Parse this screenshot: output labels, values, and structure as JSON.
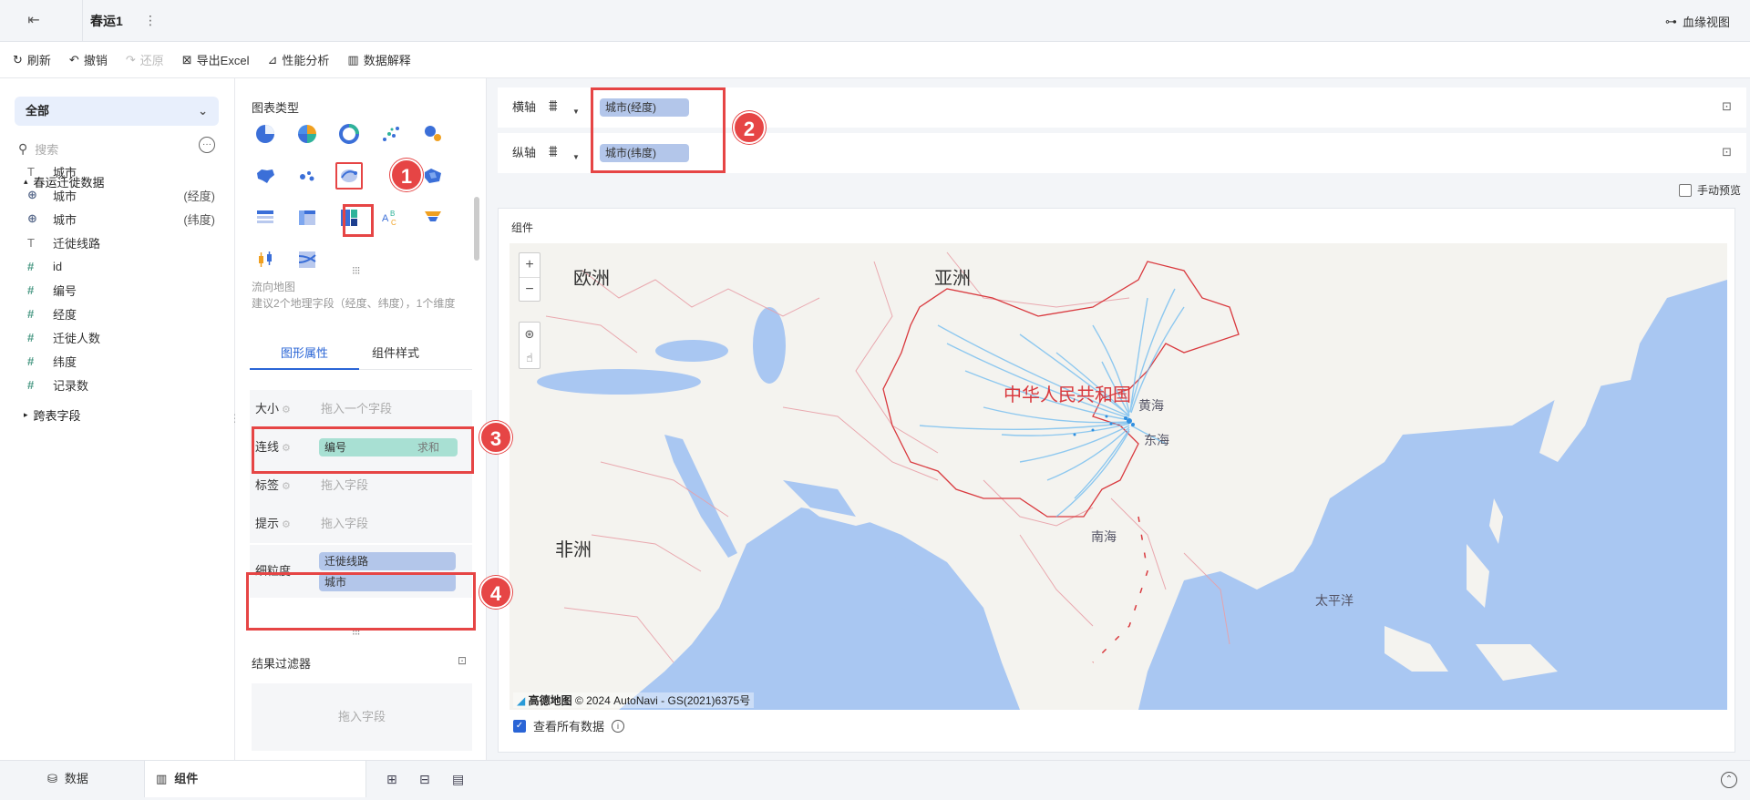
{
  "header": {
    "tab_title": "春运1",
    "more": "⋮",
    "lineage_label": "血缘视图"
  },
  "toolbar": {
    "refresh": "刷新",
    "undo": "撤销",
    "redo": "还原",
    "export_excel": "导出Excel",
    "perf_analysis": "性能分析",
    "data_explain": "数据解释"
  },
  "fields_panel": {
    "dropdown_value": "全部",
    "search_placeholder": "搜索",
    "dataset_name": "春运迁徙数据",
    "fields": [
      {
        "icon": "T",
        "name": "城市",
        "suffix": ""
      },
      {
        "icon": "globe",
        "name": "城市",
        "suffix": "(经度)"
      },
      {
        "icon": "globe",
        "name": "城市",
        "suffix": "(纬度)"
      },
      {
        "icon": "T",
        "name": "迁徙线路",
        "suffix": ""
      },
      {
        "icon": "#",
        "name": "id",
        "suffix": ""
      },
      {
        "icon": "#",
        "name": "编号",
        "suffix": ""
      },
      {
        "icon": "#",
        "name": "经度",
        "suffix": ""
      },
      {
        "icon": "#",
        "name": "迁徙人数",
        "suffix": ""
      },
      {
        "icon": "#",
        "name": "纬度",
        "suffix": ""
      },
      {
        "icon": "#",
        "name": "记录数",
        "suffix": ""
      }
    ],
    "cross_table": "跨表字段"
  },
  "chart_panel": {
    "chart_type_label": "图表类型",
    "chart_desc_title": "流向地图",
    "chart_desc_body": "建议2个地理字段（经度、纬度），1个维度",
    "tab_props": "图形属性",
    "tab_style": "组件样式",
    "props": {
      "size_label": "大小",
      "size_drop": "拖入一个字段",
      "line_label": "连线",
      "line_field": "编号",
      "line_agg": "求和",
      "tag_label": "标签",
      "tag_drop": "拖入字段",
      "tip_label": "提示",
      "tip_drop": "拖入字段",
      "granularity_label": "细粒度",
      "granularity_fields": [
        "迁徙线路",
        "城市"
      ]
    },
    "result_filter": "结果过滤器",
    "result_filter_drop": "拖入字段"
  },
  "axes": {
    "x_label": "横轴",
    "x_field": "城市(经度)",
    "y_label": "纵轴",
    "y_field": "城市(纬度)",
    "manual_preview": "手动预览"
  },
  "component": {
    "title": "组件",
    "map_labels": {
      "europe": "欧洲",
      "asia": "亚洲",
      "africa": "非洲",
      "china": "中华人民共和国",
      "yellow_sea": "黄海",
      "east_sea": "东海",
      "south_sea": "南海",
      "pacific": "太平洋"
    },
    "attribution_logo": "高德地图",
    "attribution": "© 2024 AutoNavi - GS(2021)6375号",
    "view_all_data": "查看所有数据",
    "zoom_in": "+",
    "zoom_out": "−"
  },
  "annotations": [
    "1",
    "2",
    "3",
    "4"
  ],
  "bottom": {
    "data_tab": "数据",
    "component_tab": "组件"
  },
  "colors": {
    "accent": "#2a65d6",
    "annotation": "#e64545",
    "sea": "#a9c7f2",
    "land": "#f4f3ef",
    "border_red": "#d9393e",
    "flow": "#4aa8e8"
  }
}
